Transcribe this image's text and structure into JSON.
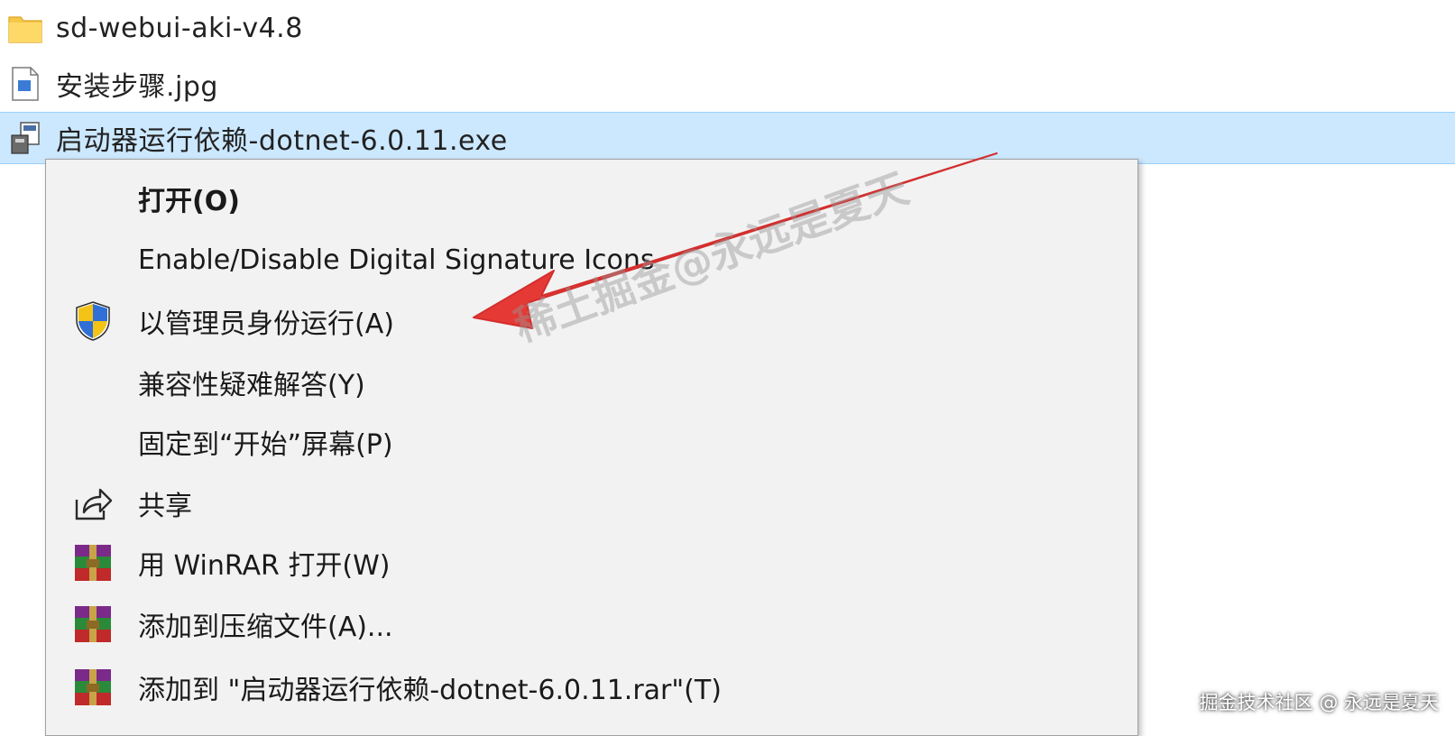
{
  "files": [
    {
      "name": "sd-webui-aki-v4.8",
      "icon": "folder-icon"
    },
    {
      "name": "安装步骤.jpg",
      "icon": "image-file-icon"
    },
    {
      "name": "启动器运行依赖-dotnet-6.0.11.exe",
      "icon": "installer-exe-icon",
      "selected": true
    }
  ],
  "context_menu": {
    "items": [
      {
        "label": "打开(O)",
        "bold": true,
        "icon": ""
      },
      {
        "label": "Enable/Disable Digital Signature Icons",
        "icon": ""
      },
      {
        "label": "以管理员身份运行(A)",
        "icon": "uac-shield-icon"
      },
      {
        "label": "兼容性疑难解答(Y)",
        "icon": ""
      },
      {
        "label": "固定到“开始”屏幕(P)",
        "icon": ""
      },
      {
        "label": "共享",
        "icon": "share-icon"
      },
      {
        "label": "用 WinRAR 打开(W)",
        "icon": "winrar-icon"
      },
      {
        "label": "添加到压缩文件(A)...",
        "icon": "winrar-icon"
      },
      {
        "label": "添加到 \"启动器运行依赖-dotnet-6.0.11.rar\"(T)",
        "icon": "winrar-icon"
      }
    ]
  },
  "watermark": "稀土掘金@永远是夏天",
  "footer_credit": "掘金技术社区 @ 永远是夏天",
  "colors": {
    "selection": "#cce8ff",
    "menu_background": "#f2f2f2",
    "annotation_arrow": "#e53935"
  }
}
